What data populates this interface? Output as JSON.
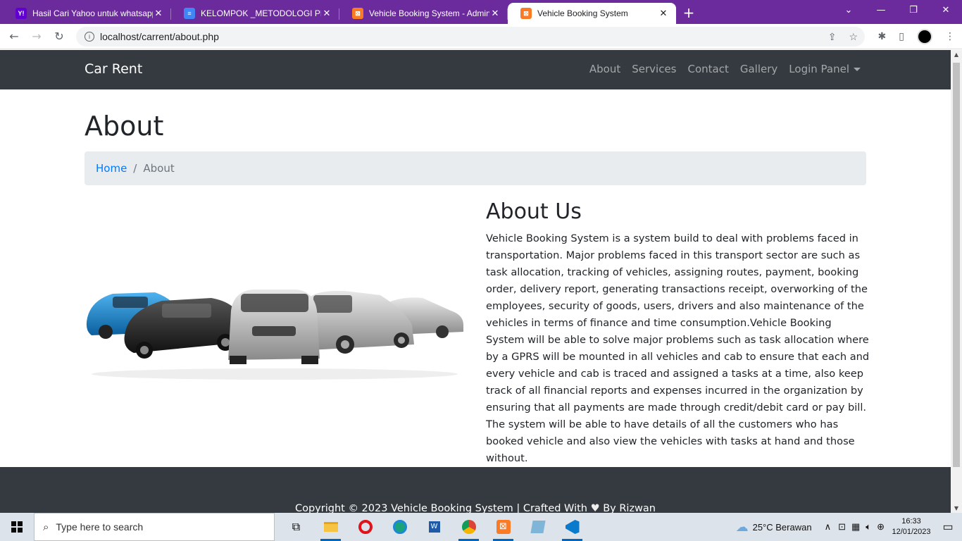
{
  "browser": {
    "tabs": [
      {
        "title": "Hasil Cari Yahoo untuk whatsapp",
        "favicon": "yahoo-icon",
        "favicon_text": "Y!",
        "color": "#6001d2",
        "active": false
      },
      {
        "title": "KELOMPOK _METODOLOGI PENGEMBANGAN",
        "favicon": "docs-icon",
        "favicon_text": "≡",
        "color": "#4285f4",
        "active": false
      },
      {
        "title": "Vehicle Booking System - Admin",
        "favicon": "xampp-icon",
        "favicon_text": "⊠",
        "color": "#fb7a24",
        "active": false
      },
      {
        "title": "Vehicle Booking System",
        "favicon": "xampp-icon",
        "favicon_text": "⊠",
        "color": "#fb7a24",
        "active": true
      }
    ],
    "url": "localhost/carrent/about.php"
  },
  "site": {
    "brand": "Car Rent",
    "nav": [
      "About",
      "Services",
      "Contact",
      "Gallery",
      "Login Panel"
    ],
    "page_title": "About",
    "breadcrumb": {
      "home": "Home",
      "current": "About"
    },
    "about_heading": "About Us",
    "about_text": "Vehicle Booking System is a system build to deal with problems faced in transportation. Major problems faced in this transport sector are such as task allocation, tracking of vehicles, assigning routes, payment, booking order, delivery report, generating transactions receipt, overworking of the employees, security of goods, users, drivers and also maintenance of the vehicles in terms of finance and time consumption.Vehicle Booking System will be able to solve major problems such as task allocation where by a GPRS will be mounted in all vehicles and cab to ensure that each and every vehicle and cab is traced and assigned a tasks at a time, also keep track of all financial reports and expenses incurred in the organization by ensuring that all payments are made through credit/debit card or pay bill. The system will be able to have details of all the customers who has booked vehicle and also view the vehicles with tasks at hand and those without.",
    "footer_text_before": "Copyright © 2023 Vehicle Booking System | Crafted With",
    "footer_text_after": "By Rizwan"
  },
  "taskbar": {
    "search_placeholder": "Type here to search",
    "weather": "25°C  Berawan",
    "time": "16:33",
    "date": "12/01/2023"
  }
}
